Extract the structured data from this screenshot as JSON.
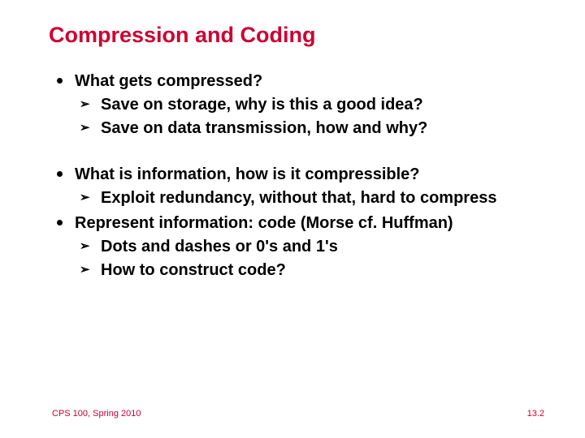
{
  "title": "Compression and Coding",
  "bullets": {
    "g1": {
      "head": "What gets compressed?",
      "a": "Save on storage, why is this a good idea?",
      "b": "Save on data transmission, how and why?"
    },
    "g2": {
      "head": "What is information, how is it compressible?",
      "a": "Exploit redundancy, without that, hard to compress"
    },
    "g3": {
      "head": "Represent information: code (Morse cf. Huffman)",
      "a": "Dots and dashes or 0's and 1's",
      "b": "How to construct code?"
    }
  },
  "footer": {
    "left": "CPS 100, Spring 2010",
    "right": "13.2"
  },
  "glyph": {
    "arrow": "➢"
  }
}
